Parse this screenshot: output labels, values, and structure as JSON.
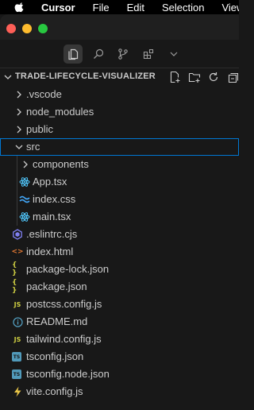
{
  "menubar": {
    "app_name": "Cursor",
    "items": [
      "File",
      "Edit",
      "Selection",
      "View"
    ]
  },
  "explorer": {
    "title": "TRADE-LIFECYCLE-VISUALIZER",
    "tree": [
      {
        "label": ".vscode",
        "kind": "folder",
        "expanded": false
      },
      {
        "label": "node_modules",
        "kind": "folder",
        "expanded": false
      },
      {
        "label": "public",
        "kind": "folder",
        "expanded": false
      },
      {
        "label": "src",
        "kind": "folder",
        "expanded": true,
        "selected": true
      },
      {
        "label": "components",
        "kind": "folder",
        "expanded": false
      },
      {
        "label": "App.tsx",
        "kind": "react-file"
      },
      {
        "label": "index.css",
        "kind": "css-file"
      },
      {
        "label": "main.tsx",
        "kind": "react-file"
      },
      {
        "label": ".eslintrc.cjs",
        "kind": "eslint-file"
      },
      {
        "label": "index.html",
        "kind": "html-file"
      },
      {
        "label": "package-lock.json",
        "kind": "json-file"
      },
      {
        "label": "package.json",
        "kind": "json-file"
      },
      {
        "label": "postcss.config.js",
        "kind": "js-file"
      },
      {
        "label": "README.md",
        "kind": "info-file"
      },
      {
        "label": "tailwind.config.js",
        "kind": "js-file"
      },
      {
        "label": "tsconfig.json",
        "kind": "ts-file"
      },
      {
        "label": "tsconfig.node.json",
        "kind": "ts-file"
      },
      {
        "label": "vite.config.js",
        "kind": "vite-file"
      }
    ]
  },
  "icon_glyphs": {
    "json": "{ }",
    "js": "JS",
    "ts": "TS",
    "html": "<>",
    "info": "i"
  },
  "colors": {
    "accent": "#0078d4",
    "react": "#4fc3f7",
    "css": "#42a5f5",
    "json": "#cbcb41",
    "js": "#cbcb41",
    "ts": "#519aba",
    "html": "#e37933",
    "eslint": "#8080f2",
    "info": "#519aba",
    "vite": "#e8c547"
  }
}
